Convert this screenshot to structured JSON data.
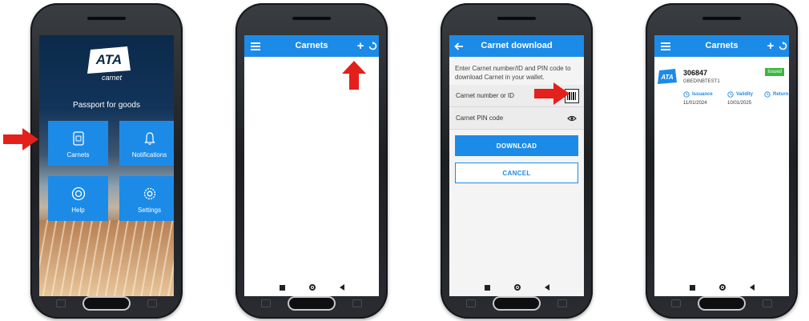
{
  "screen1": {
    "logo_text": "ATA",
    "logo_sub": "carnet",
    "tagline": "Passport for goods",
    "tiles": [
      {
        "label": "Carnets",
        "icon": "document-icon"
      },
      {
        "label": "Notifications",
        "icon": "bell-icon"
      },
      {
        "label": "Help",
        "icon": "lifebuoy-icon"
      },
      {
        "label": "Settings",
        "icon": "gear-icon"
      }
    ]
  },
  "screen2": {
    "title": "Carnets"
  },
  "screen3": {
    "title": "Carnet download",
    "intro": "Enter Carnet number/ID and PIN code to download Carnet in your wallet.",
    "number_placeholder": "Carnet number or ID",
    "pin_placeholder": "Carnet PIN code",
    "download_label": "DOWNLOAD",
    "cancel_label": "CANCEL"
  },
  "screen4": {
    "title": "Carnets",
    "card": {
      "logo_text": "ATA",
      "number": "306847",
      "holder": "GBEDINBTEST1",
      "status": "Issued",
      "issuance_label": "Issuance",
      "issuance_date": "11/01/2024",
      "validity_label": "Validity",
      "validity_date": "10/01/2025",
      "return_label": "Return"
    }
  },
  "colors": {
    "accent": "#1c8be8",
    "arrow": "#e3201b",
    "status_green": "#3fb542"
  }
}
